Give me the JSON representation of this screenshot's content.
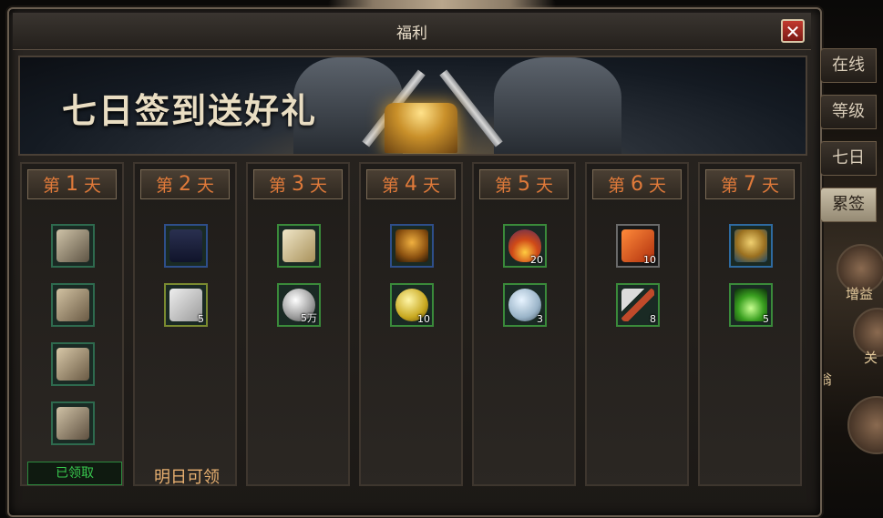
{
  "window": {
    "title": "福利",
    "close_icon": "✕"
  },
  "banner": {
    "title": "七日签到送好礼"
  },
  "side_tabs": [
    {
      "label": "在线",
      "active": false
    },
    {
      "label": "等级",
      "active": false
    },
    {
      "label": "七日",
      "active": false
    },
    {
      "label": "累签",
      "active": true
    }
  ],
  "side_icons": [
    {
      "label": "增益"
    },
    {
      "label": "关"
    },
    {
      "label": "翁"
    }
  ],
  "days": [
    {
      "prefix": "第",
      "num": "1",
      "suffix": "天",
      "items": [
        {
          "icon": "gloves-icon",
          "count": ""
        },
        {
          "icon": "chest-armor-icon",
          "count": ""
        },
        {
          "icon": "pauldron-armor-icon",
          "count": ""
        },
        {
          "icon": "boots-icon",
          "count": ""
        }
      ],
      "status": "已领取"
    },
    {
      "prefix": "第",
      "num": "2",
      "suffix": "天",
      "items": [
        {
          "icon": "suit-jacket-icon",
          "count": ""
        },
        {
          "icon": "paper-ticket-icon",
          "count": "5"
        }
      ],
      "status": "明日可领"
    },
    {
      "prefix": "第",
      "num": "3",
      "suffix": "天",
      "items": [
        {
          "icon": "scroll-icon",
          "count": ""
        },
        {
          "icon": "silver-coin-icon",
          "count": "5万"
        }
      ],
      "status": ""
    },
    {
      "prefix": "第",
      "num": "4",
      "suffix": "天",
      "items": [
        {
          "icon": "tiger-pet-icon",
          "count": ""
        },
        {
          "icon": "gold-coin-icon",
          "count": "10"
        }
      ],
      "status": ""
    },
    {
      "prefix": "第",
      "num": "5",
      "suffix": "天",
      "items": [
        {
          "icon": "fire-egg-icon",
          "count": "20"
        },
        {
          "icon": "diamond-coin-icon",
          "count": "3"
        }
      ],
      "status": ""
    },
    {
      "prefix": "第",
      "num": "6",
      "suffix": "天",
      "items": [
        {
          "icon": "gift-box-icon",
          "count": "10"
        },
        {
          "icon": "hammer-icon",
          "count": "8"
        }
      ],
      "status": ""
    },
    {
      "prefix": "第",
      "num": "7",
      "suffix": "天",
      "items": [
        {
          "icon": "golden-mount-icon",
          "count": ""
        },
        {
          "icon": "green-pendant-icon",
          "count": "5"
        }
      ],
      "status": ""
    }
  ]
}
